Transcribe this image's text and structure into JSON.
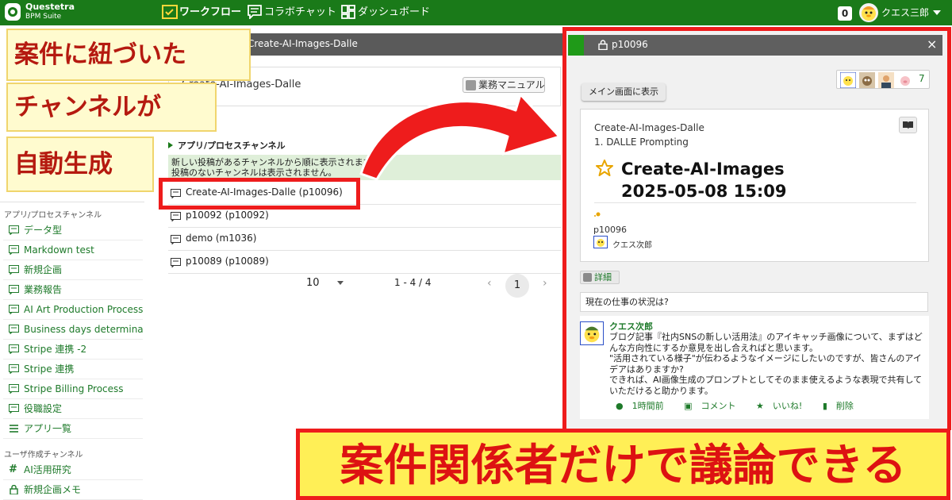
{
  "topbar": {
    "brand": "Questetra",
    "brand_sub": "BPM Suite",
    "nav_workflow": "ワークフロー",
    "nav_chat": "コラボチャット",
    "nav_dashboard": "ダッシュボード",
    "notif_count": "0",
    "user_name": "クエス三郎"
  },
  "callouts": {
    "line1": "案件に紐づいた",
    "line2": "チャンネルが",
    "line3": "自動生成",
    "bottom": "案件関係者だけで議論できる"
  },
  "sidebar": {
    "section_app": "アプリ/プロセスチャンネル",
    "items": [
      {
        "label": "データ型"
      },
      {
        "label": "Markdown test"
      },
      {
        "label": "新規企画"
      },
      {
        "label": "業務報告"
      },
      {
        "label": "AI Art Production Process"
      },
      {
        "label": "Business days determina…"
      },
      {
        "label": "Stripe 連携 -2"
      },
      {
        "label": "Stripe 連携"
      },
      {
        "label": "Stripe Billing Process"
      },
      {
        "label": "役職設定"
      },
      {
        "label": "アプリ一覧"
      }
    ],
    "section_user": "ユーザ作成チャンネル",
    "user_items": [
      {
        "label": "AI活用研究"
      },
      {
        "label": "新規企画メモ"
      }
    ]
  },
  "middle": {
    "header_title": "Create-AI-Images-Dalle",
    "card_title": "Create-AI-Images-Dalle",
    "manual_button": "業務マニュアル",
    "section_title": "アプリ/プロセスチャンネル",
    "info_line1": "新しい投稿があるチャンネルから順に表示されます。",
    "info_line2": "投稿のないチャンネルは表示されません。",
    "channels": [
      {
        "label": "Create-AI-Images-Dalle (p10096)"
      },
      {
        "label": "p10092 (p10092)"
      },
      {
        "label": "demo (m1036)"
      },
      {
        "label": "p10089 (p10089)"
      }
    ],
    "page_size": "10",
    "range": "1 - 4 / 4",
    "current_page": "1"
  },
  "right": {
    "header_title": "p10096",
    "main_view_button": "メイン画面に表示",
    "member_count": "7",
    "process_app": "Create-AI-Images-Dalle",
    "process_step": "1. DALLE Prompting",
    "process_title": "Create-AI-Images",
    "process_date": "2025-05-08 15:09",
    "process_id": "p10096",
    "process_user": "クエス次郎",
    "detail_button": "詳細",
    "post_prompt": "現在の仕事の状況は?",
    "comment": {
      "author": "クエス次郎",
      "body": "ブログ記事『社内SNSの新しい活用法』のアイキャッチ画像について、まずはどんな方向性にするか意見を出し合えればと思います。\n\"活用されている様子\"が伝わるようなイメージにしたいのですが、皆さんのアイデアはありますか?\nできれば、AI画像生成のプロンプトとしてそのまま使えるような表現で共有していただけると助かります。",
      "time": "1時間前",
      "comment_label": "コメント",
      "like_label": "いいね!",
      "delete_label": "削除"
    }
  },
  "colors": {
    "brand_green": "#1a7a19",
    "callout_red": "#ee1c1c",
    "callout_yellow": "#ffef56"
  }
}
